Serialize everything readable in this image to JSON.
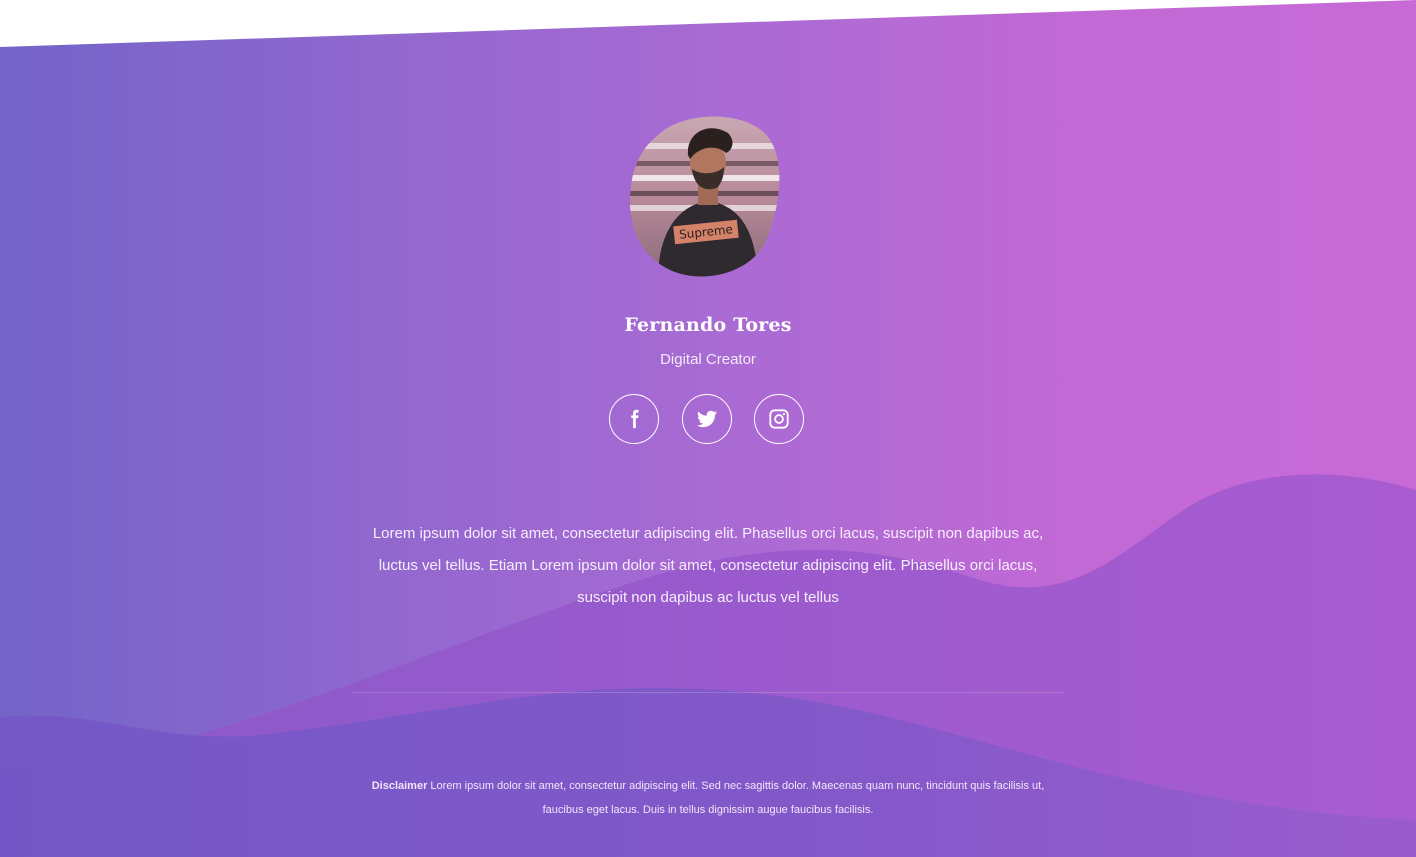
{
  "profile": {
    "name": "Fernando Tores",
    "role": "Digital Creator",
    "avatar_shirt_text": "Supreme"
  },
  "socials": [
    {
      "name": "facebook",
      "icon": "facebook-icon"
    },
    {
      "name": "twitter",
      "icon": "twitter-icon"
    },
    {
      "name": "instagram",
      "icon": "instagram-icon"
    }
  ],
  "bio": "Lorem ipsum dolor sit amet, consectetur adipiscing elit. Phasellus orci lacus, suscipit non dapibus ac, luctus vel tellus. Etiam Lorem ipsum dolor sit amet, consectetur adipiscing elit. Phasellus orci lacus, suscipit non dapibus ac luctus vel tellus",
  "footer": {
    "disclaimer_label": "Disclaimer",
    "disclaimer_text": " Lorem ipsum dolor sit amet, consectetur adipiscing elit. Sed nec sagittis dolor. Maecenas quam nunc, tincidunt quis facilisis ut, faucibus eget lacus. Duis in tellus dignissim augue faucibus facilisis."
  },
  "colors": {
    "gradient_start": "#7565c9",
    "gradient_mid": "#a46ad2",
    "gradient_end": "#c469d4",
    "wave_left": "#7a5cc8",
    "wave_right": "#a05ccd",
    "text": "#ffffff"
  }
}
